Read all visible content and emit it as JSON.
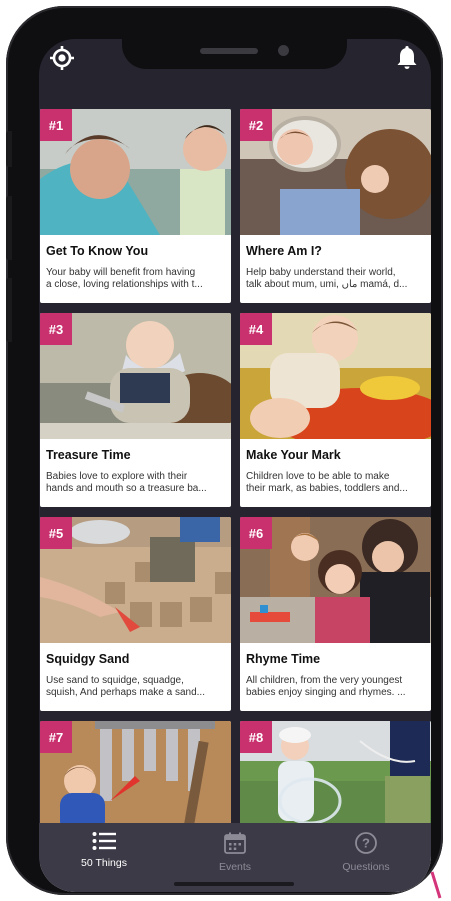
{
  "header": {
    "left_icon": "location-target-icon",
    "right_icon": "bell-icon"
  },
  "cards": [
    {
      "number": "#1",
      "title": "Get To Know You",
      "line1": "Your baby will benefit from having",
      "line2": "a close, loving relationships with t..."
    },
    {
      "number": "#2",
      "title": "Where Am I?",
      "line1": "Help baby understand their world,",
      "line2": "talk about mum, umi, ماں mamá, d..."
    },
    {
      "number": "#3",
      "title": "Treasure Time",
      "line1": "Babies love to explore with their",
      "line2": "hands and mouth so a treasure ba..."
    },
    {
      "number": "#4",
      "title": "Make Your Mark",
      "line1": "Children love to be able to make",
      "line2": "their mark, as babies, toddlers and..."
    },
    {
      "number": "#5",
      "title": "Squidgy Sand",
      "line1": "Use sand to squidge, squadge,",
      "line2": "squish, And perhaps make a sand..."
    },
    {
      "number": "#6",
      "title": "Rhyme Time",
      "line1": "All children, from the very youngest",
      "line2": "babies enjoy singing and rhymes. ..."
    },
    {
      "number": "#7"
    },
    {
      "number": "#8"
    }
  ],
  "tabbar": {
    "tabs": [
      {
        "label": "50 Things",
        "icon": "list-icon",
        "active": true
      },
      {
        "label": "Events",
        "icon": "calendar-icon",
        "active": false
      },
      {
        "label": "Questions",
        "icon": "question-icon",
        "active": false
      }
    ]
  },
  "colors": {
    "badge": "#c8306e",
    "screen_bg": "#26252f",
    "tabbar_bg": "#3b3a46",
    "accent_pink": "#d4347a"
  }
}
